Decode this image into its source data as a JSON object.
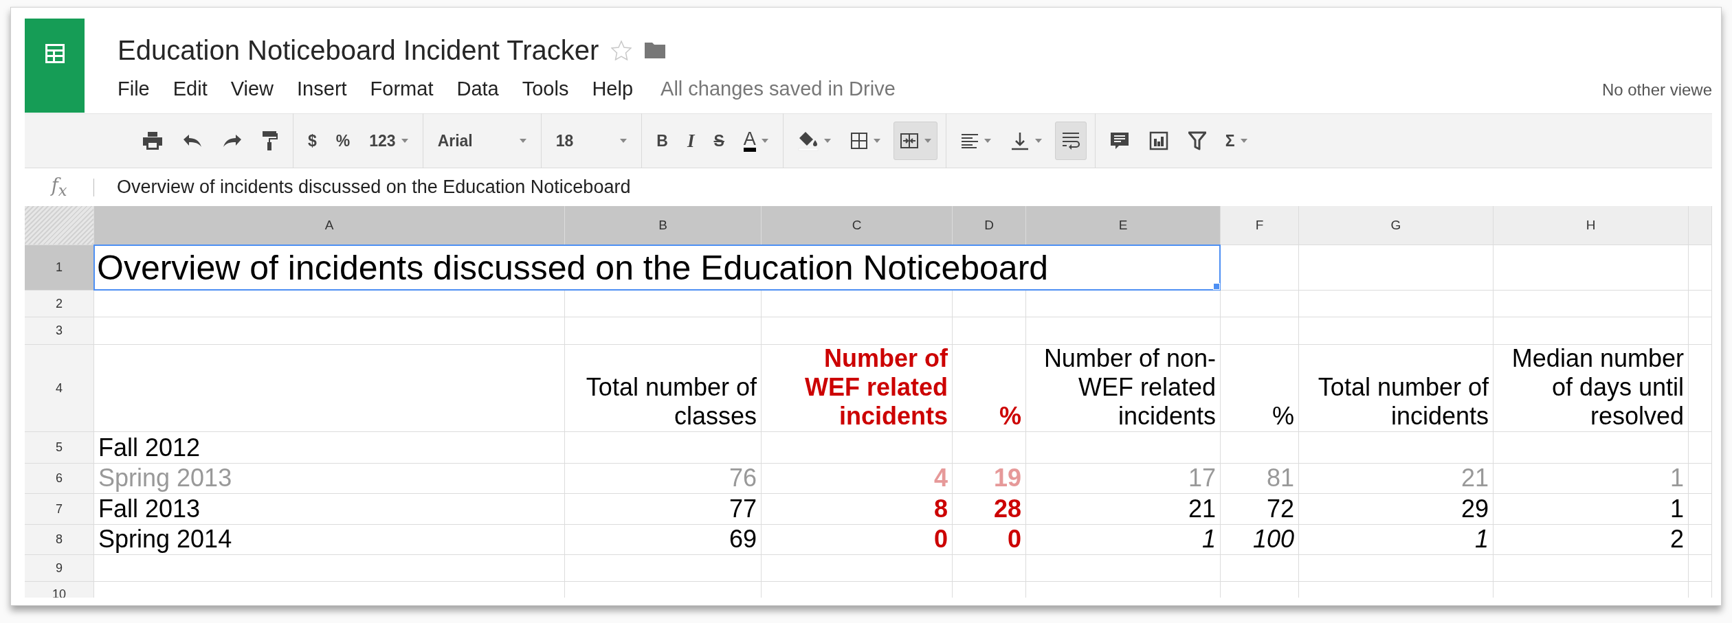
{
  "app": {
    "title": "Education Noticeboard Incident Tracker",
    "starred": false,
    "menu": [
      "File",
      "Edit",
      "View",
      "Insert",
      "Format",
      "Data",
      "Tools",
      "Help"
    ],
    "save_status": "All changes saved in Drive",
    "viewers": "No other viewe"
  },
  "toolbar": [
    [
      {
        "kind": "print",
        "pressed": false,
        "dropdown": false
      },
      {
        "kind": "undo",
        "pressed": false,
        "dropdown": false
      },
      {
        "kind": "redo",
        "pressed": false,
        "dropdown": false
      },
      {
        "kind": "paintformat",
        "pressed": false,
        "dropdown": false
      }
    ],
    [
      {
        "kind": "text",
        "text": "$",
        "pressed": false,
        "dropdown": false
      },
      {
        "kind": "text",
        "text": "%",
        "pressed": false,
        "dropdown": false
      },
      {
        "kind": "text",
        "text": "123",
        "pressed": false,
        "dropdown": true
      }
    ],
    [
      {
        "kind": "select",
        "text": "Arial",
        "pressed": false,
        "dropdown": true
      }
    ],
    [
      {
        "kind": "select",
        "text": "18",
        "pressed": false,
        "dropdown": true
      }
    ],
    [
      {
        "kind": "bold",
        "text": "B",
        "pressed": false,
        "dropdown": false
      },
      {
        "kind": "italic",
        "text": "I",
        "pressed": false,
        "dropdown": false
      },
      {
        "kind": "strike",
        "text": "S",
        "pressed": false,
        "dropdown": false
      },
      {
        "kind": "textcolor",
        "text": "A",
        "pressed": false,
        "dropdown": true
      }
    ],
    [
      {
        "kind": "fill",
        "pressed": false,
        "dropdown": true
      },
      {
        "kind": "borders",
        "pressed": false,
        "dropdown": true
      },
      {
        "kind": "merge",
        "pressed": true,
        "dropdown": true
      }
    ],
    [
      {
        "kind": "align",
        "pressed": false,
        "dropdown": true
      },
      {
        "kind": "valign",
        "pressed": false,
        "dropdown": true
      },
      {
        "kind": "wrap",
        "pressed": true,
        "dropdown": false
      }
    ],
    [
      {
        "kind": "comment",
        "pressed": false,
        "dropdown": false
      },
      {
        "kind": "chart",
        "pressed": false,
        "dropdown": false
      },
      {
        "kind": "filter",
        "pressed": false,
        "dropdown": false
      },
      {
        "kind": "text",
        "text": "Σ",
        "pressed": false,
        "dropdown": true
      }
    ]
  ],
  "formula_bar": {
    "label": "f$_{x}$",
    "value": "Overview of incidents discussed on the Education Noticeboard"
  },
  "sheet": {
    "columns": [
      {
        "label": "A",
        "selected": true
      },
      {
        "label": "B",
        "selected": true
      },
      {
        "label": "C",
        "selected": true
      },
      {
        "label": "D",
        "selected": true
      },
      {
        "label": "E",
        "selected": true
      },
      {
        "label": "F",
        "selected": false
      },
      {
        "label": "G",
        "selected": false
      },
      {
        "label": "H",
        "selected": false
      }
    ],
    "rows": [
      {
        "label": "1",
        "selected": true,
        "kind": "title",
        "cells": [
          {
            "text": "Overview of incidents discussed on the Education Noticeboard",
            "color": "#000000",
            "bold": false,
            "italic": false
          }
        ]
      },
      {
        "label": "2",
        "selected": false,
        "kind": "blank"
      },
      {
        "label": "3",
        "selected": false,
        "kind": "blank"
      },
      {
        "label": "4",
        "selected": false,
        "kind": "header",
        "cells": [
          null,
          {
            "text": "Total number of\nclasses",
            "color": "#000000",
            "bold": false,
            "italic": false
          },
          {
            "text": "Number of\nWEF related\nincidents",
            "color": "#cc0000",
            "bold": true,
            "italic": false
          },
          {
            "text": "%",
            "color": "#cc0000",
            "bold": true,
            "italic": false
          },
          {
            "text": "Number of non-\nWEF related\nincidents",
            "color": "#000000",
            "bold": false,
            "italic": false
          },
          {
            "text": "%",
            "color": "#000000",
            "bold": false,
            "italic": false
          },
          {
            "text": "Total number of\nincidents",
            "color": "#000000",
            "bold": false,
            "italic": false
          },
          {
            "text": "Median number\nof days until\nresolved",
            "color": "#000000",
            "bold": false,
            "italic": false
          }
        ]
      },
      {
        "label": "5",
        "selected": false,
        "kind": "data",
        "cells": [
          {
            "text": "Fall 2012",
            "color": "#000000",
            "bold": false,
            "italic": false
          }
        ]
      },
      {
        "label": "6",
        "selected": false,
        "kind": "data",
        "cells": [
          {
            "text": "Spring 2013",
            "color": "#999999",
            "bold": false,
            "italic": false
          },
          {
            "text": "76",
            "color": "#999999",
            "bold": false,
            "italic": false
          },
          {
            "text": "4",
            "color": "#e69999",
            "bold": true,
            "italic": false
          },
          {
            "text": "19",
            "color": "#e69999",
            "bold": true,
            "italic": false
          },
          {
            "text": "17",
            "color": "#999999",
            "bold": false,
            "italic": false
          },
          {
            "text": "81",
            "color": "#999999",
            "bold": false,
            "italic": false
          },
          {
            "text": "21",
            "color": "#999999",
            "bold": false,
            "italic": false
          },
          {
            "text": "1",
            "color": "#999999",
            "bold": false,
            "italic": false
          }
        ]
      },
      {
        "label": "7",
        "selected": false,
        "kind": "data",
        "cells": [
          {
            "text": "Fall 2013",
            "color": "#000000",
            "bold": false,
            "italic": false
          },
          {
            "text": "77",
            "color": "#000000",
            "bold": false,
            "italic": false
          },
          {
            "text": "8",
            "color": "#cc0000",
            "bold": true,
            "italic": false
          },
          {
            "text": "28",
            "color": "#cc0000",
            "bold": true,
            "italic": false
          },
          {
            "text": "21",
            "color": "#000000",
            "bold": false,
            "italic": false
          },
          {
            "text": "72",
            "color": "#000000",
            "bold": false,
            "italic": false
          },
          {
            "text": "29",
            "color": "#000000",
            "bold": false,
            "italic": false
          },
          {
            "text": "1",
            "color": "#000000",
            "bold": false,
            "italic": false
          }
        ]
      },
      {
        "label": "8",
        "selected": false,
        "kind": "data",
        "cells": [
          {
            "text": "Spring 2014",
            "color": "#000000",
            "bold": false,
            "italic": false
          },
          {
            "text": "69",
            "color": "#000000",
            "bold": false,
            "italic": false
          },
          {
            "text": "0",
            "color": "#cc0000",
            "bold": true,
            "italic": false
          },
          {
            "text": "0",
            "color": "#cc0000",
            "bold": true,
            "italic": false
          },
          {
            "text": "1",
            "color": "#000000",
            "bold": false,
            "italic": true
          },
          {
            "text": "100",
            "color": "#000000",
            "bold": false,
            "italic": true
          },
          {
            "text": "1",
            "color": "#000000",
            "bold": false,
            "italic": true
          },
          {
            "text": "2",
            "color": "#000000",
            "bold": false,
            "italic": false
          }
        ]
      },
      {
        "label": "9",
        "selected": false,
        "kind": "blank"
      },
      {
        "label": "10",
        "selected": false,
        "kind": "partial"
      }
    ]
  }
}
